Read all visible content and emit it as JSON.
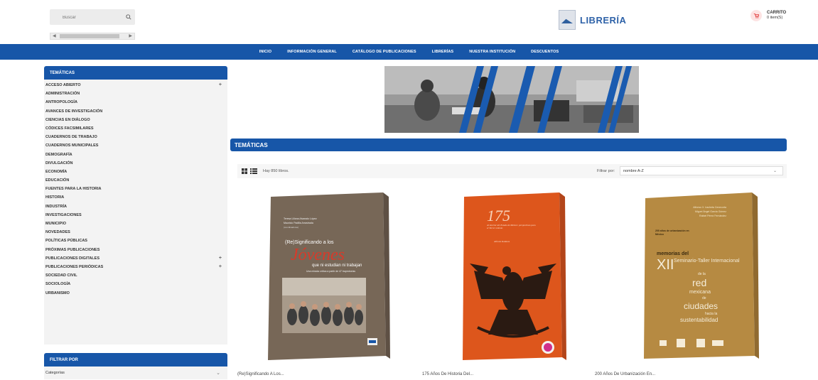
{
  "header": {
    "search_placeholder": "Buscar",
    "logo_text": "LIBRERÍA",
    "cart_label": "CARRITO",
    "cart_count": "0 item(S)"
  },
  "nav": {
    "items": [
      "INICIO",
      "INFORMACIÓN GENERAL",
      "CATÁLOGO DE PUBLICACIONES",
      "LIBRERÍAS",
      "NUESTRA INSTITUCIÓN",
      "DESCUENTOS"
    ]
  },
  "sidebar": {
    "title": "TEMÁTICAS",
    "items": [
      {
        "label": "ACCESO ABIERTO",
        "expandable": "+"
      },
      {
        "label": "ADMINISTRACIÓN"
      },
      {
        "label": "ANTROPOLOGÍA"
      },
      {
        "label": "AVANCES DE INVESTIGACIÓN"
      },
      {
        "label": "CIENCIAS EN DIÁLOGO"
      },
      {
        "label": "CÓDICES FACSIMILARES"
      },
      {
        "label": "CUADERNOS DE TRABAJO"
      },
      {
        "label": "CUADERNOS MUNICIPALES"
      },
      {
        "label": "DEMOGRAFÍA"
      },
      {
        "label": "DIVULGACIÓN"
      },
      {
        "label": "ECONOMÍA"
      },
      {
        "label": "EDUCACIÓN"
      },
      {
        "label": "FUENTES PARA LA HISTORIA"
      },
      {
        "label": "HISTORIA"
      },
      {
        "label": "INDUSTRÍA"
      },
      {
        "label": "INVESTIGACIONES"
      },
      {
        "label": "MUNICIPIO"
      },
      {
        "label": "NOVEDADES"
      },
      {
        "label": "POLÍTICAS PÚBLICAS"
      },
      {
        "label": "PRÓXIMAS PUBLICACIONES"
      },
      {
        "label": "PUBLICACIONES DIGITALES",
        "expandable": "+"
      },
      {
        "label": "PUBLICACIONES PERIÓDICAS",
        "expandable": "+"
      },
      {
        "label": "SOCIEDAD CIVIL"
      },
      {
        "label": "SOCIOLOGÍA"
      },
      {
        "label": "URBANISMO"
      }
    ],
    "filter_title": "FILTRAR POR",
    "filter_category": "Categorías"
  },
  "main": {
    "section_title": "TEMÁTICAS",
    "count_text": "Hay 850 libros.",
    "filter_label": "Filtrar por:",
    "sort_value": "nombre A-Z"
  },
  "products": [
    {
      "title": "(Re)Significando A Los...",
      "cover_color": "#8b7b6a",
      "cover_lines": [
        "Teresa Liliana Alvarado López",
        "Mauricio Padilla Arrastrada",
        "(coordinadores)"
      ],
      "cover_title_a": "(Re)Significando a los",
      "cover_title_b": "Jóvenes",
      "cover_title_c": "que ni estudian ni trabajan",
      "cover_sub": "Una mirada crítica a partir de 47 trayectorias"
    },
    {
      "title": "175 Años De Historia Del...",
      "cover_color": "#e0591e",
      "cover_big": "175",
      "cover_sub": "Al interior del Estado de México: perspectivas para el Tercer milenio",
      "cover_author": "Alfredo Ramírez"
    },
    {
      "title": "200 Años De Urbanización En...",
      "cover_color": "#b98d45",
      "cover_authors": [
        "Alfonso X. Iracheta Cenecorta",
        "Miguel Ángel García Gómez",
        "Rafael Pérez Fernández"
      ],
      "cover_top": "200 años de urbanización en México",
      "cover_mem": "memorias del",
      "cover_xii": "XII",
      "cover_seminario": "Seminario-Taller Internacional",
      "cover_de": "de la",
      "cover_red": "red",
      "cover_mex": "mexicana",
      "cover_de2": "de",
      "cover_ciudades": "ciudades",
      "cover_hacia": "hacia la",
      "cover_sust": "sustentabilidad"
    }
  ]
}
